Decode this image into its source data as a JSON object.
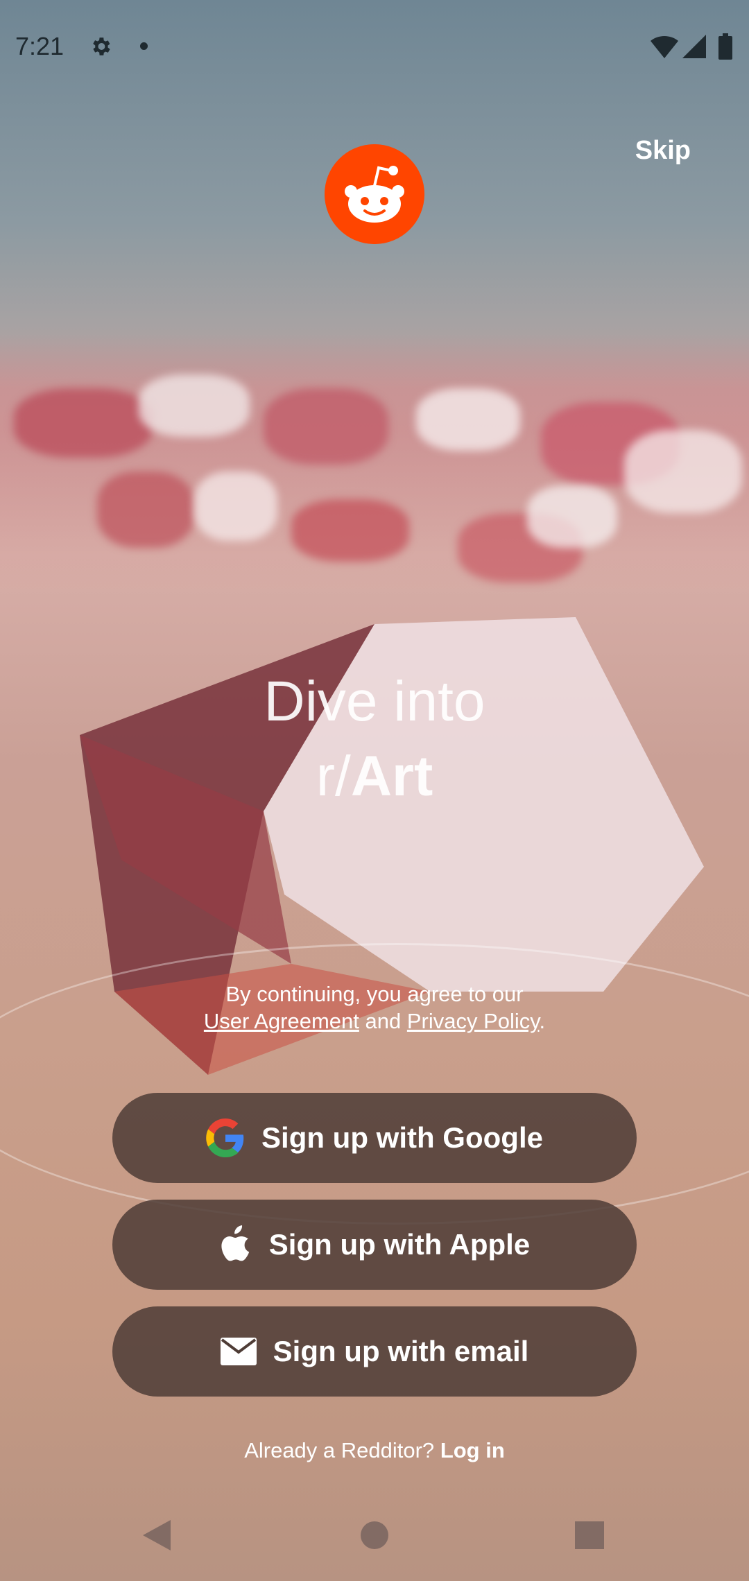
{
  "status_bar": {
    "time": "7:21"
  },
  "header": {
    "skip_label": "Skip"
  },
  "hero": {
    "line1": "Dive into",
    "line2_prefix": "r/",
    "line2_bold": "Art"
  },
  "legal": {
    "prefix": "By continuing, you agree to our",
    "user_agreement": "User Agreement",
    "and": "and",
    "privacy_policy": "Privacy Policy",
    "suffix": "."
  },
  "buttons": {
    "google": "Sign up with Google",
    "apple": "Sign up with Apple",
    "email": "Sign up with email"
  },
  "login": {
    "prompt": "Already a Redditor?",
    "action": "Log in"
  },
  "colors": {
    "brand": "#ff4500",
    "button_bg": "#4e3c36"
  }
}
